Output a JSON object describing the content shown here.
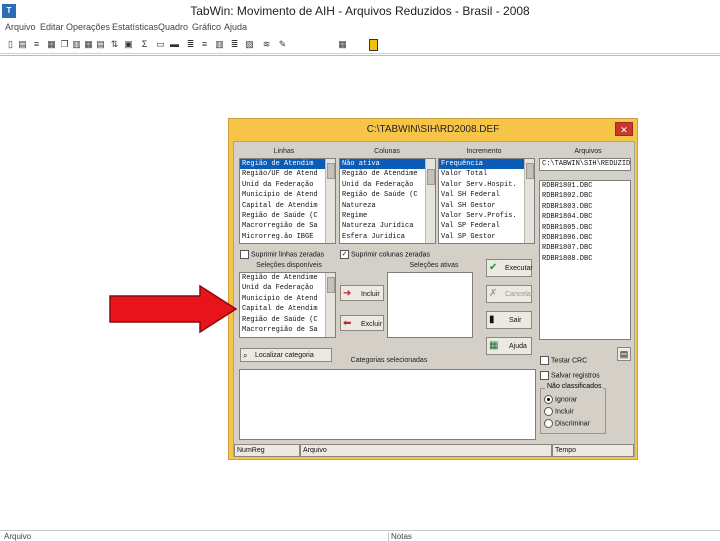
{
  "window": {
    "title": "TabWin: Movimento de AIH - Arquivos Reduzidos - Brasil - 2008",
    "icon_text": "T"
  },
  "menu": [
    "Arquivo",
    "Editar",
    "Operações",
    "Estatísticas",
    "Quadro",
    "Gráfico",
    "Ajuda"
  ],
  "toolbar_icons": [
    "new-file-icon",
    "open-icon",
    "list-icon",
    "table-icon",
    "copy-icon",
    "paste-icon",
    "grid-icon",
    "grid2-icon",
    "sort-icon",
    "print-icon",
    "print2-icon",
    "align-icon",
    "align2-icon",
    "bars-icon",
    "bars2-icon",
    "filter-icon",
    "sum-icon",
    "wrench-icon",
    "calc-icon",
    "yellow-bar-icon"
  ],
  "dialog": {
    "title": "C:\\TABWIN\\SIH\\RD2008.DEF",
    "close_label": "✕",
    "linhas_label": "Linhas",
    "colunas_label": "Colunas",
    "incremento_label": "Incremento",
    "arquivos_label": "Arquivos",
    "linhas": [
      "Região de Atendim",
      "Região/UF de Atend",
      "Unid da Federação",
      "Município de Atend",
      "Capital de Atendim",
      "Região de Saúde (C",
      "Macrorregião de Sa",
      "Microrreg.ão IBGE"
    ],
    "colunas": [
      "Não ativa",
      "Região de Atendime",
      "Unid da Federação",
      "Região de Saúde (C",
      "Natureza",
      "Regime",
      "Natureza Jurídica",
      "Esfera Jurídica"
    ],
    "incremento": [
      "Frequência",
      "Valor Total",
      "Valor Serv.Hospit.",
      "Val SH Federal",
      "Val SH Gestor",
      "Valor Serv.Profis.",
      "Val SP Federal",
      "Val SP Gestor"
    ],
    "arquivos_path": "C:\\TABWIN\\SIH\\REDUZIDOS\\F",
    "arquivos": [
      "RDBR1801.DBC",
      "RDBR1802.DBC",
      "RDBR1803.DBC",
      "RDBR1804.DBC",
      "RDBR1805.DBC",
      "RDBR1806.DBC",
      "RDBR1807.DBC",
      "RDBR1808.DBC"
    ],
    "suprimir_linhas": "Suprimir linhas zeradas",
    "suprimir_colunas": "Suprimir colunas zeradas",
    "selecoes_disponiveis_label": "Seleções disponíveis",
    "selecoes_ativas_label": "Seleções ativas",
    "selecoes_disponiveis": [
      "Região de Atendime",
      "Unid da Federação",
      "Município de Atend",
      "Capital de Atendim",
      "Região de Saúde (C",
      "Macrorregião de Sa"
    ],
    "incluir_label": "Incluir",
    "excluir_label": "Excluir",
    "executar_label": "Executar",
    "cancelar_label": "Cancelar",
    "sair_label": "Sair",
    "ajuda_label": "Ajuda",
    "localizar_label": "Localizar categoria",
    "categorias_label": "Categorias selecionadas",
    "testar_crc": "Testar CRC",
    "salvar_registros": "Salvar registros",
    "nao_classificados_label": "Não classificados",
    "opcoes": [
      "Ignorar",
      "Incluir",
      "Discriminar"
    ],
    "status_cells": [
      "NumReg",
      "Arquivo",
      "Tempo"
    ]
  },
  "statusbar": [
    "Arquivo",
    "Notas"
  ],
  "colors": {
    "dialog_frame": "#f6c548",
    "arrow": "#e8141b",
    "selection": "#0a5cb8"
  }
}
